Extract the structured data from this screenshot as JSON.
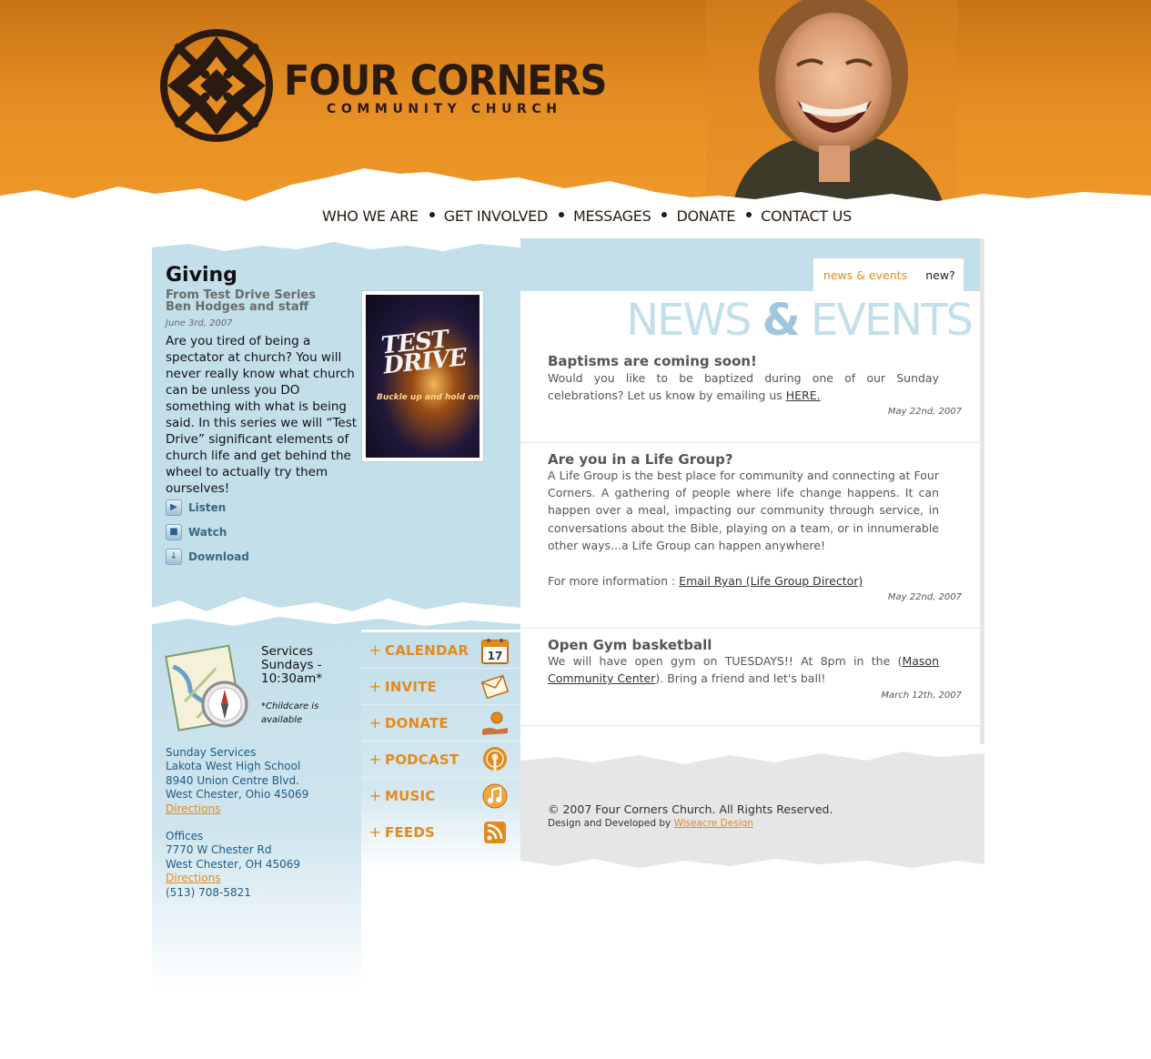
{
  "site": {
    "brand_name": "FOUR CORNERS",
    "brand_sub": "COMMUNITY CHURCH"
  },
  "nav": {
    "items": [
      "WHO WE ARE",
      "GET INVOLVED",
      "MESSAGES",
      "DONATE",
      "CONTACT US"
    ]
  },
  "feature": {
    "title": "Giving",
    "series_line1": "From Test Drive Series",
    "series_line2": "Ben Hodges and staff",
    "date": "June 3rd, 2007",
    "body": "Are you tired of being a spectator at church? You will never really know what church can be unless you DO something with what is being said. In this series we will “Test Drive” significant elements of church life and get behind the wheel to actually try them ourselves!",
    "art_title": "TEST DRIVE",
    "art_tag": "Buckle up and hold on",
    "links": [
      "Listen",
      "Watch",
      "Download"
    ]
  },
  "news": {
    "tab_active": "news & events",
    "tab_other": "new?",
    "heading_left": "NEWS",
    "heading_amp": "&",
    "heading_right": "EVENTS",
    "items": [
      {
        "title": "Baptisms are coming soon!",
        "body": "Would you like to be baptized during one of our Sunday celebrations? Let us know by emailing us ",
        "link": "HERE.",
        "date": "May 22nd, 2007"
      },
      {
        "title": "Are you in a Life Group?",
        "body": "A Life Group is the best place for community and connecting at Four Corners. A gathering of people where life change happens. It can happen over a meal, impacting our community through service, in conversations about the Bible, playing on a team, or in innumerable other ways...a Life Group can happen anywhere!",
        "more_prefix": "For more information : ",
        "link": "Email Ryan (Life Group Director)",
        "date": "May 22nd, 2007"
      },
      {
        "title": "Open Gym basketball",
        "body_pre": "We will have open gym on TUESDAYS!! At 8pm in the (",
        "link": "Mason Community Center",
        "body_post": "). Bring a friend and let's ball!",
        "date": "March 12th, 2007"
      }
    ]
  },
  "services": {
    "title": "Services Sundays - 10:30am*",
    "note": "*Childcare is available",
    "sunday_label": "Sunday Services",
    "sunday_venue": "Lakota West High School",
    "sunday_street": "8940 Union Centre Blvd.",
    "sunday_city": "West Chester, Ohio 45069",
    "directions": "Directions",
    "offices_label": "Offices",
    "offices_street": "7770 W Chester Rd",
    "offices_city": "West Chester, OH 45069",
    "phone": "(513) 708-5821"
  },
  "quicklinks": [
    "CALENDAR",
    "INVITE",
    "DONATE",
    "PODCAST",
    "MUSIC",
    "FEEDS"
  ],
  "calendar_day": "17",
  "footer": {
    "copyright": "© 2007 Four Corners Church. All Rights Reserved.",
    "credit_prefix": "Design and Developed by ",
    "credit_link": "Wiseacre Design"
  },
  "colors": {
    "orange": "#e48a1c",
    "header_orange": "#e58d22",
    "light_blue": "#c3dfea",
    "link_blue": "#1f5a87",
    "footer_grey": "#e6e6e6"
  }
}
